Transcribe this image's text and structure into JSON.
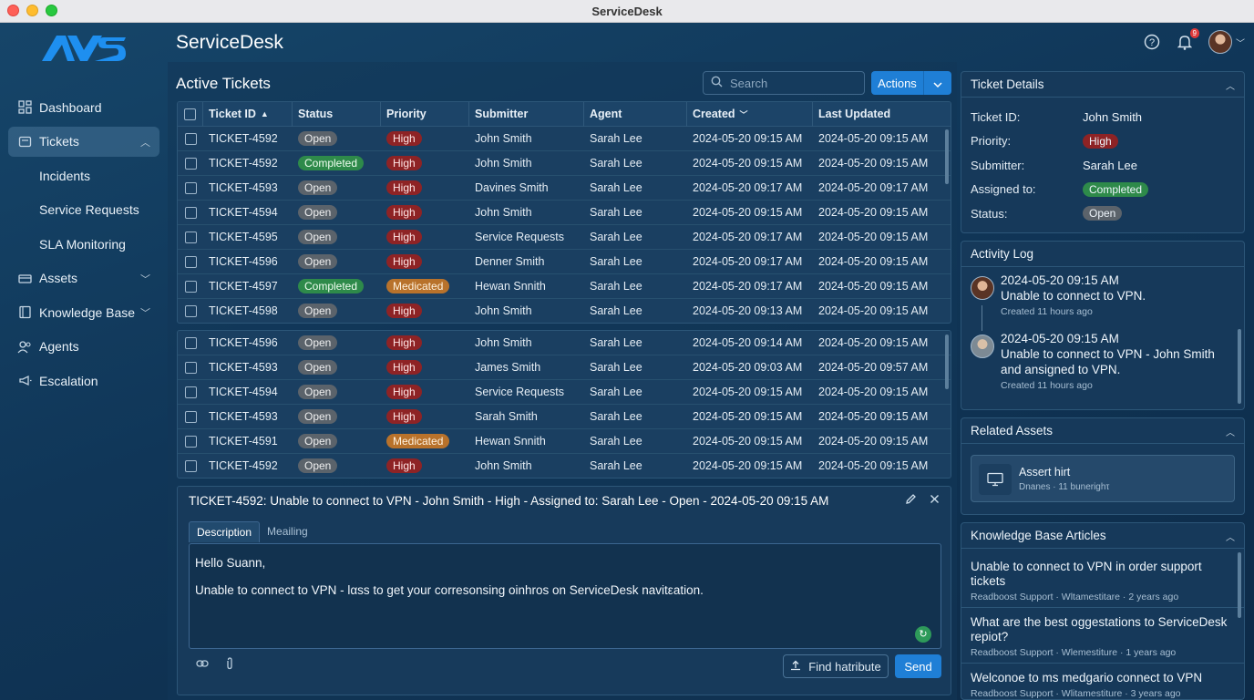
{
  "window": {
    "title": "ServiceDesk"
  },
  "header": {
    "app_title": "ServiceDesk",
    "notification_count": "9"
  },
  "sidebar": {
    "items": [
      {
        "label": "Dashboard"
      },
      {
        "label": "Tickets"
      },
      {
        "label": "Incidents"
      },
      {
        "label": "Service Requests"
      },
      {
        "label": "SLA Monitoring"
      },
      {
        "label": "Assets"
      },
      {
        "label": "Knowledge Base"
      },
      {
        "label": "Agents"
      },
      {
        "label": "Escalation"
      }
    ]
  },
  "tickets": {
    "section_title": "Active Tickets",
    "search_placeholder": "Search",
    "actions_label": "Actions",
    "columns": [
      "Ticket ID",
      "Status",
      "Priority",
      "Submitter",
      "Agent",
      "Created",
      "Last Updated"
    ],
    "rows": [
      {
        "id": "TICKET-4592",
        "status": "Open",
        "priority": "High",
        "submitter": "John Smith",
        "agent": "Sarah Lee",
        "created": "2024-05-20 09:15 AM",
        "updated": "2024-05-20 09:15 AM"
      },
      {
        "id": "TICKET-4592",
        "status": "Completed",
        "priority": "High",
        "submitter": "John Smith",
        "agent": "Sarah Lee",
        "created": "2024-05-20 09:15 AM",
        "updated": "2024-05-20 09:15 AM"
      },
      {
        "id": "TICKET-4593",
        "status": "Open",
        "priority": "High",
        "submitter": "Davines Smith",
        "agent": "Sarah Lee",
        "created": "2024-05-20 09:17 AM",
        "updated": "2024-05-20 09:17 AM"
      },
      {
        "id": "TICKET-4594",
        "status": "Open",
        "priority": "High",
        "submitter": "John Smith",
        "agent": "Sarah Lee",
        "created": "2024-05-20 09:15 AM",
        "updated": "2024-05-20 09:15 AM"
      },
      {
        "id": "TICKET-4595",
        "status": "Open",
        "priority": "High",
        "submitter": "Service Requests",
        "agent": "Sarah Lee",
        "created": "2024-05-20 09:17 AM",
        "updated": "2024-05-20 09:15 AM"
      },
      {
        "id": "TICKET-4596",
        "status": "Open",
        "priority": "High",
        "submitter": "Denner Smith",
        "agent": "Sarah Lee",
        "created": "2024-05-20 09:17 AM",
        "updated": "2024-05-20 09:15 AM"
      },
      {
        "id": "TICKET-4597",
        "status": "Completed",
        "priority": "Medicated",
        "submitter": "Hewan Snnith",
        "agent": "Sarah Lee",
        "created": "2024-05-20 09:17 AM",
        "updated": "2024-05-20 09:15 AM"
      },
      {
        "id": "TICKET-4598",
        "status": "Open",
        "priority": "High",
        "submitter": "John Smith",
        "agent": "Sarah Lee",
        "created": "2024-05-20 09:13 AM",
        "updated": "2024-05-20 09:15 AM"
      }
    ],
    "rows2": [
      {
        "id": "TICKET-4596",
        "status": "Open",
        "priority": "High",
        "submitter": "John Smith",
        "agent": "Sarah Lee",
        "created": "2024-05-20 09:14 AM",
        "updated": "2024-05-20 09:15 AM"
      },
      {
        "id": "TICKET-4593",
        "status": "Open",
        "priority": "High",
        "submitter": "James Smith",
        "agent": "Sarah Lee",
        "created": "2024-05-20 09:03 AM",
        "updated": "2024-05-20 09:57 AM"
      },
      {
        "id": "TICKET-4594",
        "status": "Open",
        "priority": "High",
        "submitter": "Service Requests",
        "agent": "Sarah Lee",
        "created": "2024-05-20 09:15 AM",
        "updated": "2024-05-20 09:15 AM"
      },
      {
        "id": "TICKET-4593",
        "status": "Open",
        "priority": "High",
        "submitter": "Sarah Smith",
        "agent": "Sarah Lee",
        "created": "2024-05-20 09:15 AM",
        "updated": "2024-05-20 09:15 AM"
      },
      {
        "id": "TICKET-4591",
        "status": "Open",
        "priority": "Medicated",
        "submitter": "Hewan Snnith",
        "agent": "Sarah Lee",
        "created": "2024-05-20 09:15 AM",
        "updated": "2024-05-20 09:15 AM"
      },
      {
        "id": "TICKET-4592",
        "status": "Open",
        "priority": "High",
        "submitter": "John Smith",
        "agent": "Sarah Lee",
        "created": "2024-05-20 09:15 AM",
        "updated": "2024-05-20 09:15 AM"
      }
    ]
  },
  "detail": {
    "title": "TICKET-4592: Unable to connect to VPN - John Smith - High - Assigned to: Sarah Lee - Open - 2024-05-20 09:15 AM",
    "tabs": [
      "Description",
      "Meailing"
    ],
    "greeting": "Hello Suann,",
    "body": "Unable to connect to VPN - lαss to get your corresonsing oinhros on  ServiceDesk navitεation.",
    "find_label": "Find hatribute",
    "send_label": "Send"
  },
  "ticket_details": {
    "title": "Ticket Details",
    "fields": [
      {
        "key": "Ticket ID:",
        "value": "John Smith"
      },
      {
        "key": "Priority:",
        "value": "High"
      },
      {
        "key": "Submitter:",
        "value": "Sarah Lee"
      },
      {
        "key": "Assigned to:",
        "value": "Completed"
      },
      {
        "key": "Status:",
        "value": "Open"
      }
    ]
  },
  "activity_log": {
    "title": "Activity Log",
    "entries": [
      {
        "time": "2024-05-20 09:15 AM",
        "text": "Unable to connect to VPN.",
        "meta": "Created 11 hours ago"
      },
      {
        "time": "2024-05-20 09:15 AM",
        "text": "Unable to connect to VPN - John Smith and ansigned to VPN.",
        "meta": "Created 11 hours ago"
      }
    ]
  },
  "related_assets": {
    "title": "Related Assets",
    "name": "Assert hirt",
    "sub": "Dnanes · 11 bunerighτ"
  },
  "kb_articles": {
    "title": "Knowledge Base Articles",
    "items": [
      {
        "title": "Unable to connect to VPN in order support tickets",
        "meta": "Readboost Support · Wltamestitare · 2 years ago"
      },
      {
        "title": "What are the best oggestations to ServiceDesk repiot?",
        "meta": "Readboost Support · Wlemestiture · 1 years ago"
      },
      {
        "title": "Welconoe to ms medgario connect to VPN",
        "meta": "Readboost Support · Wlitamestiture · 3 years ago"
      }
    ]
  }
}
